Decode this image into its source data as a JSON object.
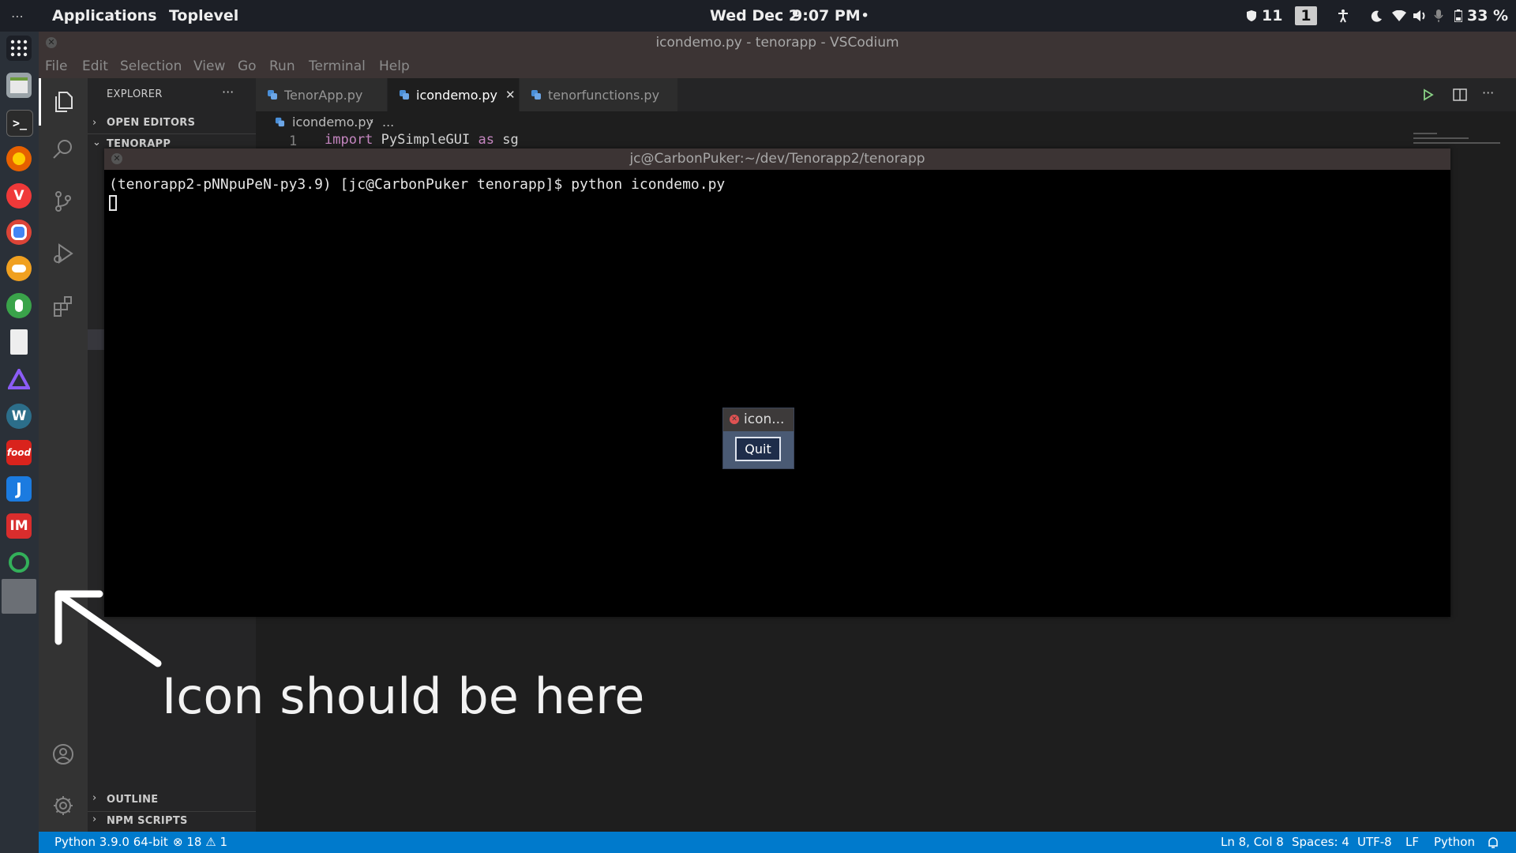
{
  "topbar": {
    "dots": "⋯",
    "applications": "Applications",
    "toplevel": "Toplevel",
    "date": "Wed Dec 2",
    "time": "9:07 PM",
    "dot": "•",
    "notif_count": "11",
    "workspace": "1",
    "battery": "33 %"
  },
  "window": {
    "title": "icondemo.py - tenorapp - VSCodium",
    "menu": [
      "File",
      "Edit",
      "Selection",
      "View",
      "Go",
      "Run",
      "Terminal",
      "Help"
    ]
  },
  "sidebar": {
    "explorer": "EXPLORER",
    "more": "···",
    "open_editors": "OPEN EDITORS",
    "project": "TENORAPP",
    "outline": "OUTLINE",
    "npm_scripts": "NPM SCRIPTS"
  },
  "tabs": [
    {
      "label": "TenorApp.py",
      "active": false
    },
    {
      "label": "icondemo.py",
      "active": true
    },
    {
      "label": "tenorfunctions.py",
      "active": false
    }
  ],
  "breadcrumbs": {
    "file": "icondemo.py",
    "more": "..."
  },
  "code": {
    "line_number": "1",
    "kw1": "import",
    "module": "PySimpleGUI",
    "kw2": "as",
    "alias": "sg"
  },
  "terminal": {
    "title": "jc@CarbonPuker:~/dev/Tenorapp2/tenorapp",
    "line": "(tenorapp2-pNNpuPeN-py3.9) [jc@CarbonPuker tenorapp]$ python icondemo.py"
  },
  "dialog": {
    "title": "icon...",
    "button": "Quit"
  },
  "annotation": {
    "text": "Icon should be here"
  },
  "statusbar": {
    "python": "Python 3.9.0 64-bit",
    "errors": "18",
    "warnings": "1",
    "position": "Ln 8, Col 8",
    "spaces": "Spaces: 4",
    "encoding": "UTF-8",
    "eol": "LF",
    "language": "Python"
  },
  "colors": {
    "accent": "#007acc",
    "annotation": "#ffffff",
    "title_bar": "#3c3434"
  }
}
